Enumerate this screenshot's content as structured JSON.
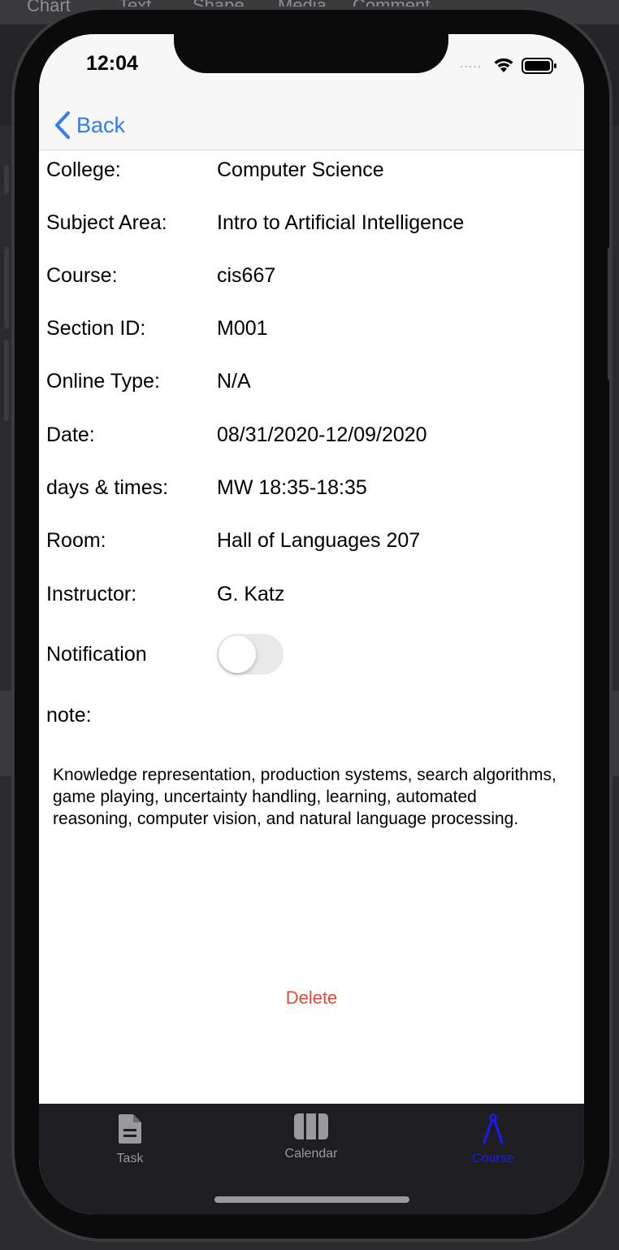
{
  "host_toolbar": {
    "items": [
      "Chart",
      "Text",
      "Shape",
      "Media",
      "Comment"
    ]
  },
  "status_bar": {
    "time": "12:04",
    "signal": "....."
  },
  "nav": {
    "back_label": "Back"
  },
  "details": [
    {
      "label": "College:",
      "value": "Computer Science"
    },
    {
      "label": "Subject Area:",
      "value": "Intro to Artificial Intelligence"
    },
    {
      "label": "Course:",
      "value": "cis667"
    },
    {
      "label": "Section ID:",
      "value": "M001"
    },
    {
      "label": "Online Type:",
      "value": "N/A"
    },
    {
      "label": "Date:",
      "value": "08/31/2020-12/09/2020"
    },
    {
      "label": "days & times:",
      "value": "MW 18:35-18:35"
    },
    {
      "label": "Room:",
      "value": "Hall of Languages 207"
    },
    {
      "label": "Instructor:",
      "value": "G. Katz"
    }
  ],
  "notification": {
    "label": "Notification",
    "enabled": false
  },
  "note": {
    "label": "note:",
    "text": "Knowledge representation, production systems, search algorithms, game playing, uncertainty handling, learning, automated reasoning, computer vision, and natural language processing."
  },
  "delete_label": "Delete",
  "tabs": [
    {
      "label": "Task",
      "icon": "document-icon",
      "active": false
    },
    {
      "label": "Calendar",
      "icon": "calendar-columns-icon",
      "active": false
    },
    {
      "label": "Course",
      "icon": "compass-icon",
      "active": true
    }
  ],
  "colors": {
    "accent": "#2f7cf6",
    "destructive": "#e34a3f",
    "tab_active": "#1a1aff",
    "tab_inactive": "#9a9a9e"
  }
}
